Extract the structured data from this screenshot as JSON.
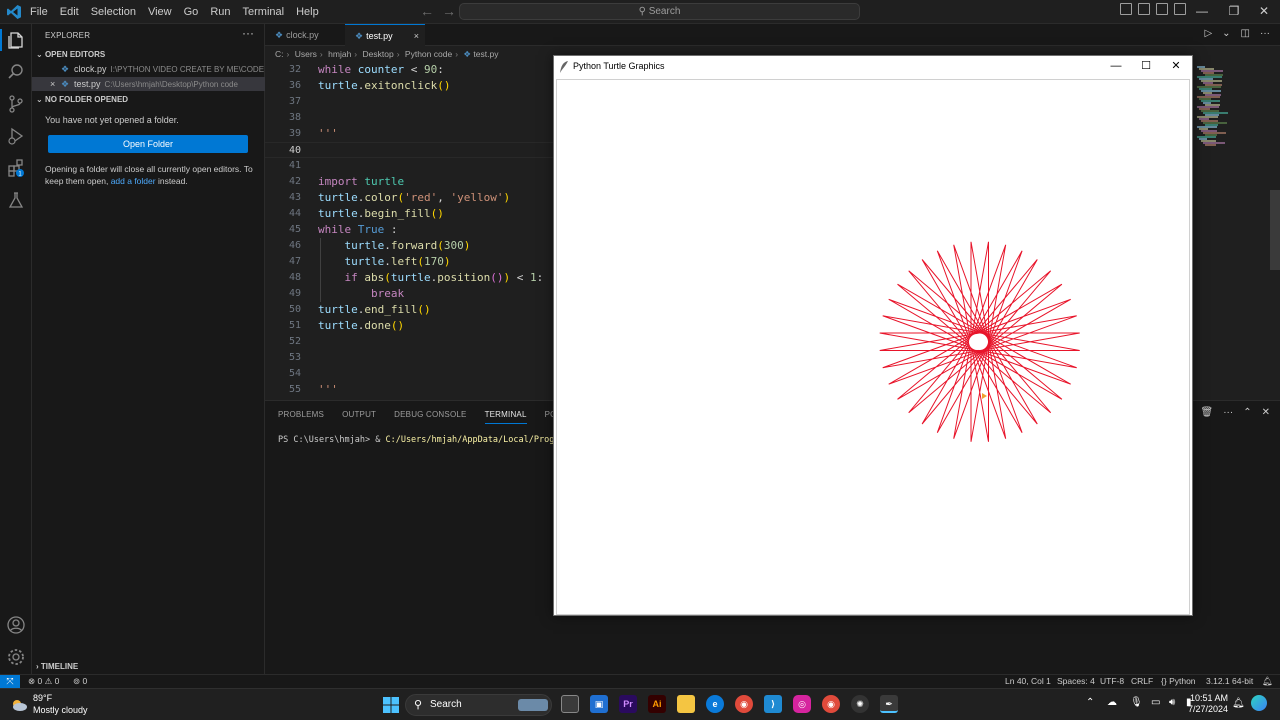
{
  "menubar": [
    "File",
    "Edit",
    "Selection",
    "View",
    "Go",
    "Run",
    "Terminal",
    "Help"
  ],
  "search": {
    "label": "Search"
  },
  "sidebar": {
    "header": "EXPLORER",
    "open_editors_title": "OPEN EDITORS",
    "open_editors": [
      {
        "name": "clock.py",
        "path": "I:\\PYTHON VIDEO CREATE BY ME\\CODE & ...",
        "close": ""
      },
      {
        "name": "test.py",
        "path": "C:\\Users\\hmjah\\Desktop\\Python code",
        "close": "×"
      }
    ],
    "no_folder_title": "NO FOLDER OPENED",
    "no_folder_text": "You have not yet opened a folder.",
    "open_folder_button": "Open Folder",
    "note_part1": "Opening a folder will close all currently open editors. To keep them open, ",
    "note_link": "add a folder",
    "note_part2": " instead.",
    "timeline_title": "TIMELINE"
  },
  "tabs": [
    {
      "label": "clock.py",
      "close": ""
    },
    {
      "label": "test.py",
      "close": "×"
    }
  ],
  "breadcrumb": [
    "C:",
    "Users",
    "hmjah",
    "Desktop",
    "Python code",
    "test.py"
  ],
  "code": {
    "lines": [
      {
        "n": "32",
        "tokens": [
          [
            "kw",
            "while"
          ],
          [
            "plain",
            " "
          ],
          [
            "var",
            "counter"
          ],
          [
            "plain",
            " < "
          ],
          [
            "num",
            "90"
          ],
          [
            "plain",
            ":"
          ]
        ]
      },
      {
        "n": "36",
        "tokens": [
          [
            "var",
            "turtle"
          ],
          [
            "plain",
            "."
          ],
          [
            "fn",
            "exitonclick"
          ],
          [
            "brk1",
            "()"
          ]
        ]
      },
      {
        "n": "37",
        "tokens": []
      },
      {
        "n": "38",
        "tokens": []
      },
      {
        "n": "39",
        "tokens": [
          [
            "str",
            "'''"
          ]
        ]
      },
      {
        "n": "40",
        "tokens": []
      },
      {
        "n": "41",
        "tokens": []
      },
      {
        "n": "42",
        "tokens": [
          [
            "kw",
            "import"
          ],
          [
            "plain",
            " "
          ],
          [
            "mod",
            "turtle"
          ]
        ]
      },
      {
        "n": "43",
        "tokens": [
          [
            "var",
            "turtle"
          ],
          [
            "plain",
            "."
          ],
          [
            "fn",
            "color"
          ],
          [
            "brk1",
            "("
          ],
          [
            "str",
            "'red'"
          ],
          [
            "plain",
            ", "
          ],
          [
            "str",
            "'yellow'"
          ],
          [
            "brk1",
            ")"
          ]
        ]
      },
      {
        "n": "44",
        "tokens": [
          [
            "var",
            "turtle"
          ],
          [
            "plain",
            "."
          ],
          [
            "fn",
            "begin_fill"
          ],
          [
            "brk1",
            "()"
          ]
        ]
      },
      {
        "n": "45",
        "tokens": [
          [
            "kw",
            "while"
          ],
          [
            "plain",
            " "
          ],
          [
            "kw2",
            "True"
          ],
          [
            "plain",
            " :"
          ]
        ]
      },
      {
        "n": "46",
        "tokens": [
          [
            "plain",
            "    "
          ],
          [
            "var",
            "turtle"
          ],
          [
            "plain",
            "."
          ],
          [
            "fn",
            "forward"
          ],
          [
            "brk1",
            "("
          ],
          [
            "num",
            "300"
          ],
          [
            "brk1",
            ")"
          ]
        ]
      },
      {
        "n": "47",
        "tokens": [
          [
            "plain",
            "    "
          ],
          [
            "var",
            "turtle"
          ],
          [
            "plain",
            "."
          ],
          [
            "fn",
            "left"
          ],
          [
            "brk1",
            "("
          ],
          [
            "num",
            "170"
          ],
          [
            "brk1",
            ")"
          ]
        ]
      },
      {
        "n": "48",
        "tokens": [
          [
            "plain",
            "    "
          ],
          [
            "kw",
            "if"
          ],
          [
            "plain",
            " "
          ],
          [
            "fn",
            "abs"
          ],
          [
            "brk1",
            "("
          ],
          [
            "var",
            "turtle"
          ],
          [
            "plain",
            "."
          ],
          [
            "fn",
            "position"
          ],
          [
            "brk2",
            "()"
          ],
          [
            "brk1",
            ")"
          ],
          [
            "plain",
            " < "
          ],
          [
            "num",
            "1"
          ],
          [
            "plain",
            ":"
          ]
        ]
      },
      {
        "n": "49",
        "tokens": [
          [
            "plain",
            "        "
          ],
          [
            "kw",
            "break"
          ]
        ]
      },
      {
        "n": "50",
        "tokens": [
          [
            "var",
            "turtle"
          ],
          [
            "plain",
            "."
          ],
          [
            "fn",
            "end_fill"
          ],
          [
            "brk1",
            "()"
          ]
        ]
      },
      {
        "n": "51",
        "tokens": [
          [
            "var",
            "turtle"
          ],
          [
            "plain",
            "."
          ],
          [
            "fn",
            "done"
          ],
          [
            "brk1",
            "()"
          ]
        ]
      },
      {
        "n": "52",
        "tokens": []
      },
      {
        "n": "53",
        "tokens": []
      },
      {
        "n": "54",
        "tokens": []
      },
      {
        "n": "55",
        "tokens": [
          [
            "str",
            "'''"
          ]
        ]
      }
    ],
    "current_line": "40"
  },
  "panel": {
    "tabs": [
      "PROBLEMS",
      "OUTPUT",
      "DEBUG CONSOLE",
      "TERMINAL",
      "PORTS"
    ],
    "active_tab": "TERMINAL",
    "terminal_prompt": "PS C:\\Users\\hmjah> & ",
    "terminal_path": "C:/Users/hmjah/AppData/Local/Programs/"
  },
  "statusbar": {
    "errors": "0",
    "warnings": "0",
    "ports": "0",
    "cursor": "Ln 40, Col 1",
    "spaces": "Spaces: 4",
    "encoding": "UTF-8",
    "eol": "CRLF",
    "language": "Python",
    "interpreter": "3.12.1 64-bit"
  },
  "turtle_window": {
    "title": "Python Turtle Graphics",
    "pen_color": "#e8142a",
    "drawing": {
      "step": 300,
      "turn_degrees": 170,
      "color": "red",
      "fill": "yellow"
    }
  },
  "taskbar": {
    "weather_temp": "89°F",
    "weather_cond": "Mostly cloudy",
    "search_label": "Search",
    "time": "10:51 AM",
    "date": "7/27/2024"
  },
  "colors": {
    "accent": "#0078d4",
    "editor_bg": "#1f1f1f",
    "sidebar_bg": "#181818"
  }
}
